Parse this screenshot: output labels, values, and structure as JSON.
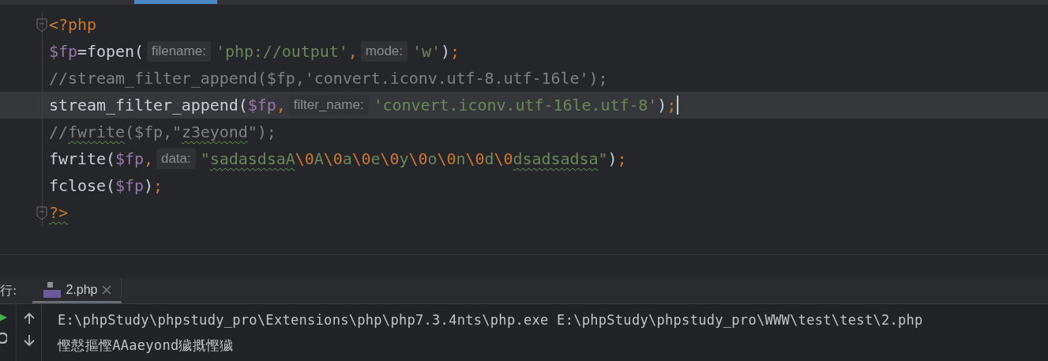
{
  "editor": {
    "lines": [
      {
        "current": false,
        "caret": false,
        "fold_marker": true,
        "segments": [
          {
            "kind": "code",
            "tokens": [
              {
                "text": "<?php",
                "kind": "keyword",
                "typo": false
              }
            ]
          }
        ]
      },
      {
        "current": false,
        "caret": false,
        "fold_marker": false,
        "segments": [
          {
            "kind": "code",
            "tokens": [
              {
                "text": "$fp",
                "kind": "variable",
                "typo": false
              },
              {
                "text": "=fopen(",
                "kind": "plain",
                "typo": false
              }
            ]
          },
          {
            "kind": "hint",
            "text": "filename:"
          },
          {
            "kind": "code",
            "tokens": [
              {
                "text": "'php://output'",
                "kind": "string",
                "typo": false
              },
              {
                "text": ",",
                "kind": "keyword",
                "typo": false
              }
            ]
          },
          {
            "kind": "hint",
            "text": "mode:"
          },
          {
            "kind": "code",
            "tokens": [
              {
                "text": "'w'",
                "kind": "string",
                "typo": false
              },
              {
                "text": ")",
                "kind": "plain",
                "typo": false
              },
              {
                "text": ";",
                "kind": "keyword",
                "typo": false
              }
            ]
          }
        ]
      },
      {
        "current": false,
        "caret": false,
        "fold_marker": false,
        "segments": [
          {
            "kind": "code",
            "tokens": [
              {
                "text": "//stream_filter_append($fp,'convert.iconv.utf-8.utf-16le');",
                "kind": "comment",
                "typo": false
              }
            ]
          }
        ]
      },
      {
        "current": true,
        "caret": true,
        "fold_marker": false,
        "segments": [
          {
            "kind": "code",
            "tokens": [
              {
                "text": "stream_filter_append(",
                "kind": "plain",
                "typo": false
              },
              {
                "text": "$fp",
                "kind": "variable",
                "typo": false
              },
              {
                "text": ",",
                "kind": "keyword",
                "typo": false
              }
            ]
          },
          {
            "kind": "hint",
            "text": "filter_name:"
          },
          {
            "kind": "code",
            "tokens": [
              {
                "text": "'convert.iconv.utf-16le.utf-8'",
                "kind": "string",
                "typo": false
              },
              {
                "text": ")",
                "kind": "plain",
                "typo": false
              },
              {
                "text": ";",
                "kind": "keyword",
                "typo": false
              }
            ]
          }
        ]
      },
      {
        "current": false,
        "caret": false,
        "fold_marker": false,
        "segments": [
          {
            "kind": "code",
            "tokens": [
              {
                "text": "//",
                "kind": "comment",
                "typo": false
              },
              {
                "text": "fwrite",
                "kind": "comment",
                "typo": true
              },
              {
                "text": "($fp,\"",
                "kind": "comment",
                "typo": false
              },
              {
                "text": "z3eyond",
                "kind": "comment",
                "typo": true
              },
              {
                "text": "\");",
                "kind": "comment",
                "typo": false
              }
            ]
          }
        ]
      },
      {
        "current": false,
        "caret": false,
        "fold_marker": false,
        "segments": [
          {
            "kind": "code",
            "tokens": [
              {
                "text": "fwrite(",
                "kind": "plain",
                "typo": false
              },
              {
                "text": "$fp",
                "kind": "variable",
                "typo": false
              },
              {
                "text": ",",
                "kind": "keyword",
                "typo": false
              }
            ]
          },
          {
            "kind": "hint",
            "text": "data:"
          },
          {
            "kind": "code",
            "tokens": [
              {
                "text": "\"",
                "kind": "string",
                "typo": false
              },
              {
                "text": "sadasdsaA",
                "kind": "string",
                "typo": true
              },
              {
                "text": "\\0",
                "kind": "escape",
                "typo": false
              },
              {
                "text": "A",
                "kind": "string",
                "typo": false
              },
              {
                "text": "\\0",
                "kind": "escape",
                "typo": false
              },
              {
                "text": "a",
                "kind": "string",
                "typo": false
              },
              {
                "text": "\\0",
                "kind": "escape",
                "typo": false
              },
              {
                "text": "e",
                "kind": "string",
                "typo": false
              },
              {
                "text": "\\0",
                "kind": "escape",
                "typo": false
              },
              {
                "text": "y",
                "kind": "string",
                "typo": false
              },
              {
                "text": "\\0",
                "kind": "escape",
                "typo": false
              },
              {
                "text": "o",
                "kind": "string",
                "typo": false
              },
              {
                "text": "\\0",
                "kind": "escape",
                "typo": false
              },
              {
                "text": "n",
                "kind": "string",
                "typo": false
              },
              {
                "text": "\\0",
                "kind": "escape",
                "typo": false
              },
              {
                "text": "d",
                "kind": "string",
                "typo": false
              },
              {
                "text": "\\0",
                "kind": "escape",
                "typo": false
              },
              {
                "text": "dsadsadsa",
                "kind": "string",
                "typo": true
              },
              {
                "text": "\"",
                "kind": "string",
                "typo": false
              },
              {
                "text": ")",
                "kind": "plain",
                "typo": false
              },
              {
                "text": ";",
                "kind": "keyword",
                "typo": false
              }
            ]
          }
        ]
      },
      {
        "current": false,
        "caret": false,
        "fold_marker": false,
        "segments": [
          {
            "kind": "code",
            "tokens": [
              {
                "text": "fclose(",
                "kind": "plain",
                "typo": false
              },
              {
                "text": "$fp",
                "kind": "variable",
                "typo": false
              },
              {
                "text": ")",
                "kind": "plain",
                "typo": false
              },
              {
                "text": ";",
                "kind": "keyword",
                "typo": false
              }
            ]
          }
        ]
      },
      {
        "current": false,
        "caret": false,
        "fold_marker": true,
        "segments": [
          {
            "kind": "code",
            "tokens": [
              {
                "text": "?>",
                "kind": "keyword",
                "typo": true
              }
            ]
          }
        ]
      }
    ]
  },
  "run_panel": {
    "label": "行:",
    "tabs": [
      {
        "label": "2.php",
        "selected": true
      }
    ],
    "output": [
      "E:\\phpStudy\\phpstudy_pro\\Extensions\\php\\php7.3.4nts\\php.exe E:\\phpStudy\\phpstudy_pro\\WWW\\test\\test\\2.php",
      "慳慤摳慳AAaeyond獩摡慳獩"
    ]
  }
}
